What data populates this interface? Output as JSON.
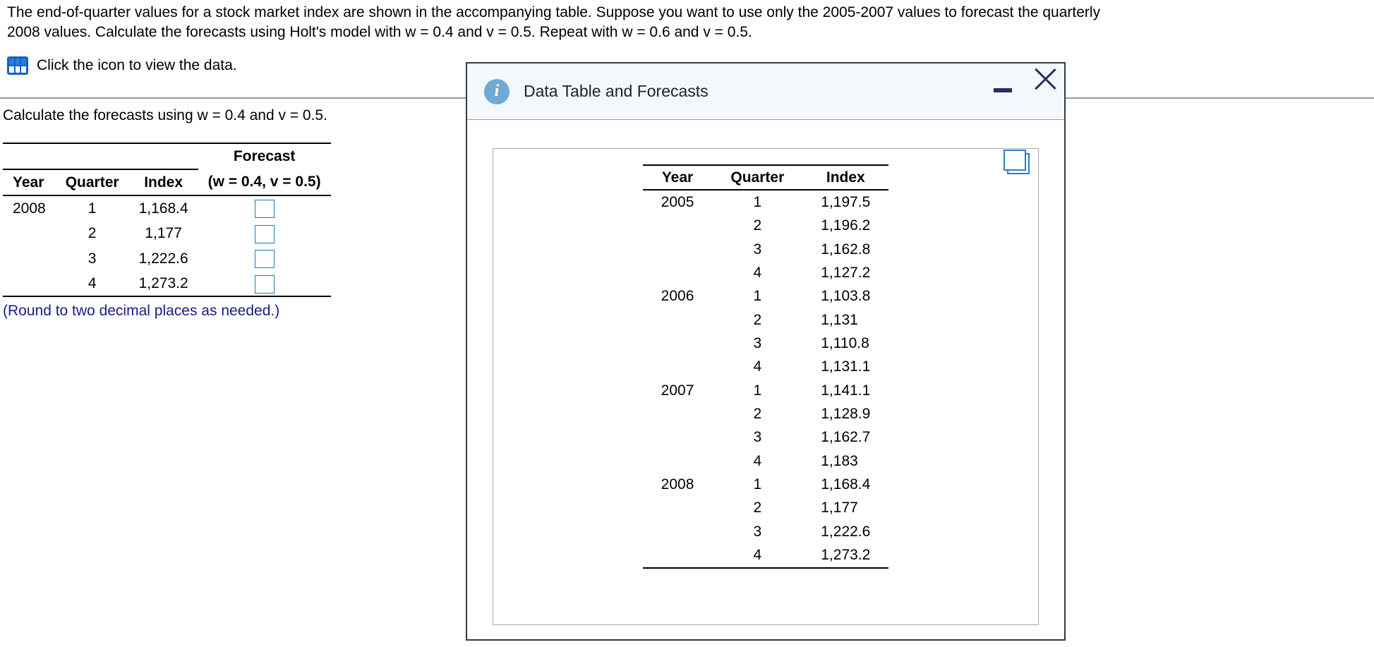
{
  "prompt": {
    "line1": "The end-of-quarter values for a stock market index are shown in the accompanying table. Suppose you want to use only the 2005-2007 values to forecast the quarterly",
    "line2": "2008 values. Calculate the forecasts using Holt's model with w = 0.4 and v = 0.5. Repeat with w = 0.6 and v = 0.5.",
    "click_icon_text": "Click the icon to view the data."
  },
  "answer_section": {
    "instruction": "Calculate the forecasts using w = 0.4 and v = 0.5.",
    "headers": {
      "year": "Year",
      "quarter": "Quarter",
      "index": "Index",
      "forecast_line1": "Forecast",
      "forecast_line2": "(w = 0.4, v = 0.5)"
    },
    "rows": [
      {
        "year": "2008",
        "quarter": "1",
        "index": "1,168.4"
      },
      {
        "year": "",
        "quarter": "2",
        "index": "1,177"
      },
      {
        "year": "",
        "quarter": "3",
        "index": "1,222.6"
      },
      {
        "year": "",
        "quarter": "4",
        "index": "1,273.2"
      }
    ],
    "note": "(Round to two decimal places as needed.)"
  },
  "modal": {
    "title": "Data Table and Forecasts",
    "headers": {
      "year": "Year",
      "quarter": "Quarter",
      "index": "Index"
    },
    "rows": [
      {
        "year": "2005",
        "quarter": "1",
        "index": "1,197.5"
      },
      {
        "year": "",
        "quarter": "2",
        "index": "1,196.2"
      },
      {
        "year": "",
        "quarter": "3",
        "index": "1,162.8"
      },
      {
        "year": "",
        "quarter": "4",
        "index": "1,127.2"
      },
      {
        "year": "2006",
        "quarter": "1",
        "index": "1,103.8"
      },
      {
        "year": "",
        "quarter": "2",
        "index": "1,131"
      },
      {
        "year": "",
        "quarter": "3",
        "index": "1,110.8"
      },
      {
        "year": "",
        "quarter": "4",
        "index": "1,131.1"
      },
      {
        "year": "2007",
        "quarter": "1",
        "index": "1,141.1"
      },
      {
        "year": "",
        "quarter": "2",
        "index": "1,128.9"
      },
      {
        "year": "",
        "quarter": "3",
        "index": "1,162.7"
      },
      {
        "year": "",
        "quarter": "4",
        "index": "1,183"
      },
      {
        "year": "2008",
        "quarter": "1",
        "index": "1,168.4"
      },
      {
        "year": "",
        "quarter": "2",
        "index": "1,177"
      },
      {
        "year": "",
        "quarter": "3",
        "index": "1,222.6"
      },
      {
        "year": "",
        "quarter": "4",
        "index": "1,273.2"
      }
    ]
  }
}
